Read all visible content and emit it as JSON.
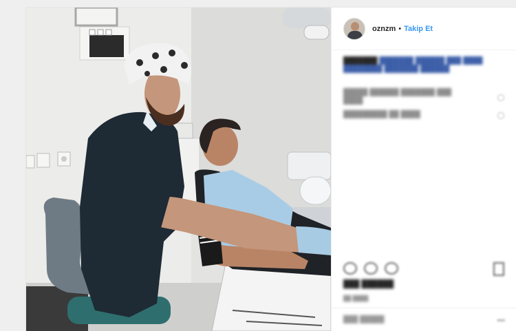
{
  "post": {
    "username": "oznzm",
    "separator": "•",
    "follow_label": "Takip Et",
    "follow_color": "#3897f0"
  },
  "comments_blurred": true,
  "icons": [
    "avatar",
    "heart-icon",
    "comment-icon",
    "share-icon",
    "bookmark-icon",
    "more-icon"
  ]
}
